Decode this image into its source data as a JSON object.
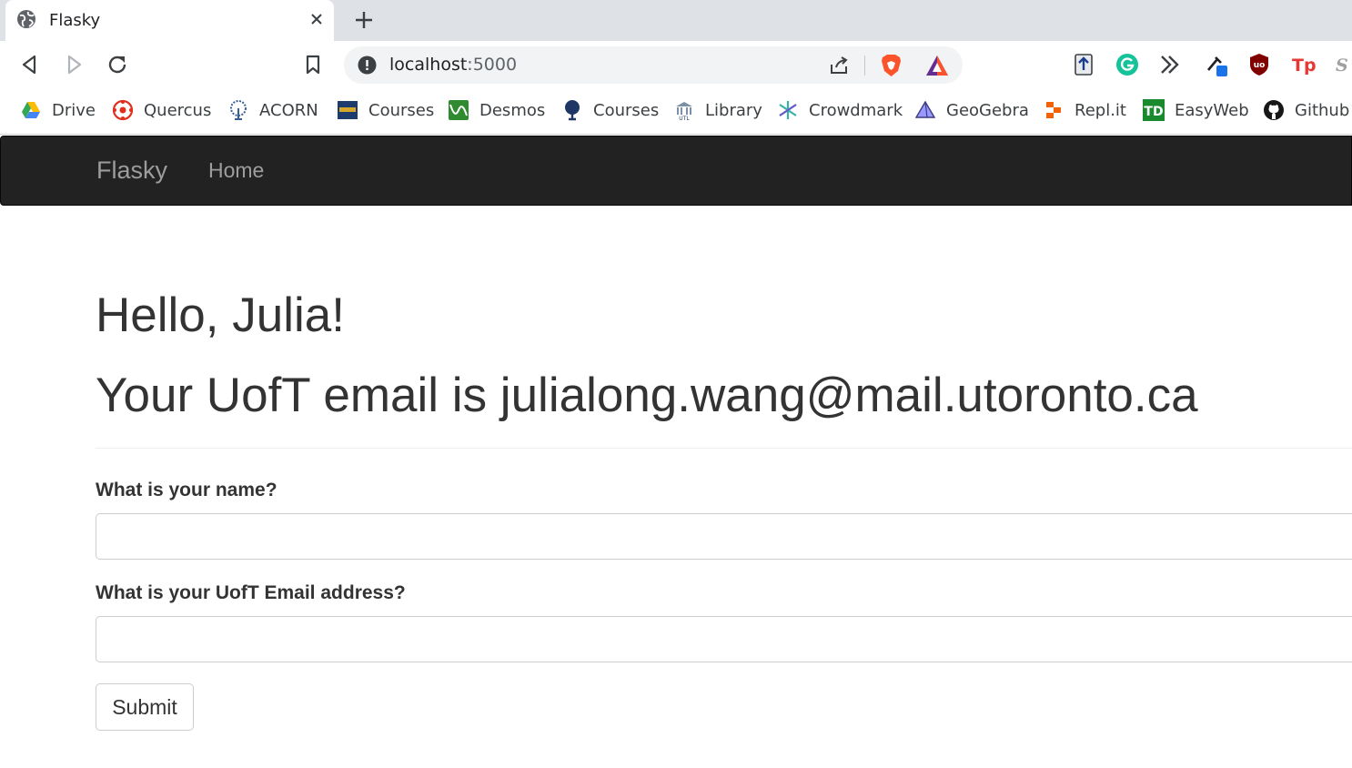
{
  "browser": {
    "tab": {
      "title": "Flasky"
    },
    "address": {
      "host": "localhost",
      "port": ":5000"
    },
    "bookmarks": [
      {
        "label": "Drive",
        "icon": "google-drive-icon"
      },
      {
        "label": "Quercus",
        "icon": "quercus-icon"
      },
      {
        "label": "ACORN",
        "icon": "acorn-icon"
      },
      {
        "label": "Courses",
        "icon": "courses-icon"
      },
      {
        "label": "Desmos",
        "icon": "desmos-icon"
      },
      {
        "label": "Courses",
        "icon": "tree-icon"
      },
      {
        "label": "Library",
        "icon": "library-icon"
      },
      {
        "label": "Crowdmark",
        "icon": "crowdmark-icon"
      },
      {
        "label": "GeoGebra",
        "icon": "geogebra-icon"
      },
      {
        "label": "Repl.it",
        "icon": "replit-icon"
      },
      {
        "label": "EasyWeb",
        "icon": "td-icon"
      },
      {
        "label": "Github",
        "icon": "github-icon"
      }
    ]
  },
  "navbar": {
    "brand": "Flasky",
    "home": "Home"
  },
  "page": {
    "greeting": "Hello, Julia!",
    "email_line": "Your UofT email is julialong.wang@mail.utoronto.ca"
  },
  "form": {
    "name_label": "What is your name?",
    "name_value": "",
    "email_label": "What is your UofT Email address?",
    "email_value": "",
    "submit_label": "Submit"
  },
  "colors": {
    "navbar_bg": "#222222",
    "navbar_text": "#9d9d9d",
    "tabstrip_bg": "#dee1e6",
    "omnibox_bg": "#f1f3f4"
  }
}
